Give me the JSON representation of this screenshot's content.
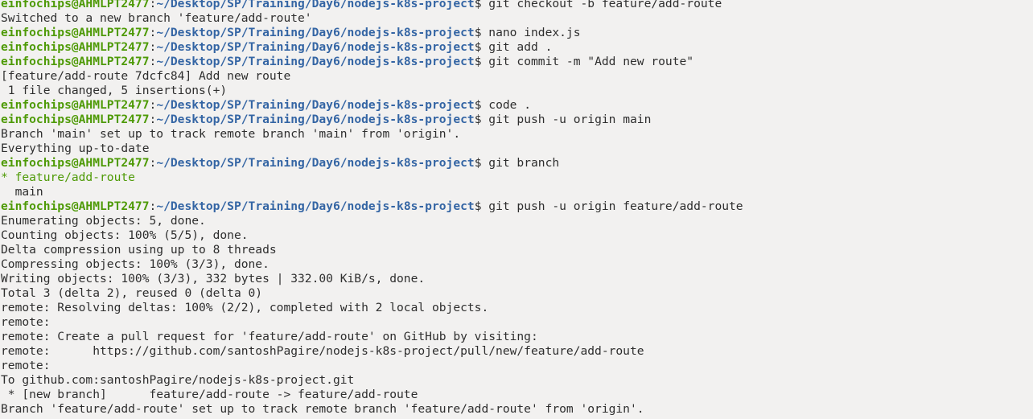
{
  "terminal": {
    "user_host": "einfochips@AHMLPT2477",
    "cwd": "~/Desktop/SP/Training/Day6/nodejs-k8s-project",
    "colors": {
      "background": "#f2f1f0",
      "text": "#2e2e2e",
      "user_host": "#4e9a06",
      "path": "#3465a4",
      "current_branch": "#4e9a06"
    },
    "lines": [
      {
        "type": "prompt",
        "command": "git checkout -b feature/add-route"
      },
      {
        "type": "output",
        "text": "Switched to a new branch 'feature/add-route'"
      },
      {
        "type": "prompt",
        "command": "nano index.js"
      },
      {
        "type": "prompt",
        "command": "git add ."
      },
      {
        "type": "prompt",
        "command": "git commit -m \"Add new route\""
      },
      {
        "type": "output",
        "text": "[feature/add-route 7dcfc84] Add new route"
      },
      {
        "type": "output",
        "text": " 1 file changed, 5 insertions(+)"
      },
      {
        "type": "prompt",
        "command": "code ."
      },
      {
        "type": "prompt",
        "command": "git push -u origin main"
      },
      {
        "type": "output",
        "text": "Branch 'main' set up to track remote branch 'main' from 'origin'."
      },
      {
        "type": "output",
        "text": "Everything up-to-date"
      },
      {
        "type": "prompt",
        "command": "git branch"
      },
      {
        "type": "output",
        "text": "* feature/add-route",
        "style": "current-branch"
      },
      {
        "type": "output",
        "text": "  main"
      },
      {
        "type": "prompt",
        "command": "git push -u origin feature/add-route"
      },
      {
        "type": "output",
        "text": "Enumerating objects: 5, done."
      },
      {
        "type": "output",
        "text": "Counting objects: 100% (5/5), done."
      },
      {
        "type": "output",
        "text": "Delta compression using up to 8 threads"
      },
      {
        "type": "output",
        "text": "Compressing objects: 100% (3/3), done."
      },
      {
        "type": "output",
        "text": "Writing objects: 100% (3/3), 332 bytes | 332.00 KiB/s, done."
      },
      {
        "type": "output",
        "text": "Total 3 (delta 2), reused 0 (delta 0)"
      },
      {
        "type": "output",
        "text": "remote: Resolving deltas: 100% (2/2), completed with 2 local objects."
      },
      {
        "type": "output",
        "text": "remote: "
      },
      {
        "type": "output",
        "text": "remote: Create a pull request for 'feature/add-route' on GitHub by visiting:"
      },
      {
        "type": "output",
        "text": "remote:      https://github.com/santoshPagire/nodejs-k8s-project/pull/new/feature/add-route"
      },
      {
        "type": "output",
        "text": "remote: "
      },
      {
        "type": "output",
        "text": "To github.com:santoshPagire/nodejs-k8s-project.git"
      },
      {
        "type": "output",
        "text": " * [new branch]      feature/add-route -> feature/add-route"
      },
      {
        "type": "output",
        "text": "Branch 'feature/add-route' set up to track remote branch 'feature/add-route' from 'origin'."
      }
    ]
  }
}
